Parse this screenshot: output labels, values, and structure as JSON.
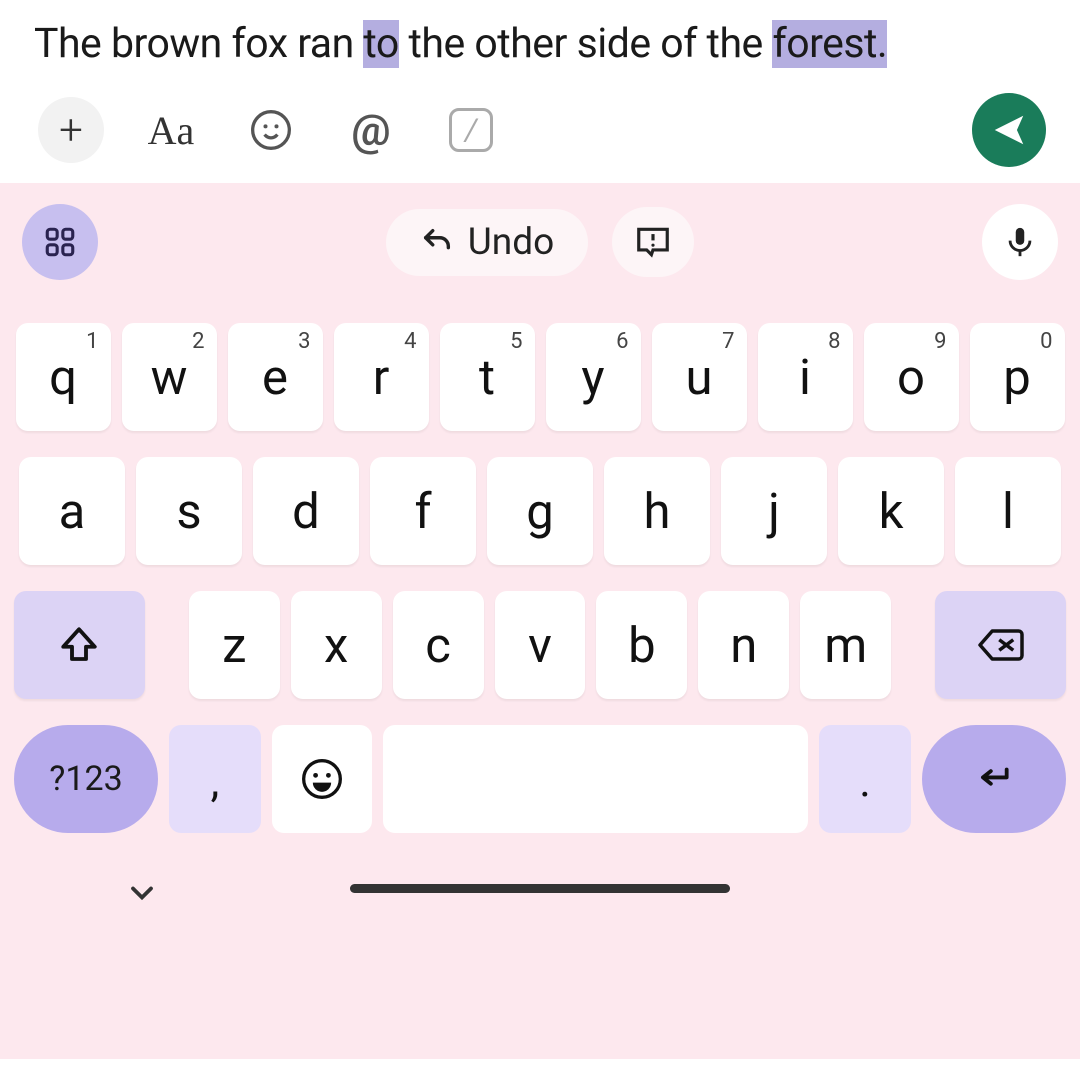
{
  "compose": {
    "segments": [
      {
        "t": "The brown fox ran ",
        "hl": false
      },
      {
        "t": "to",
        "hl": true
      },
      {
        "t": " the other side of the ",
        "hl": false
      },
      {
        "t": "forest.",
        "hl": true
      }
    ]
  },
  "format_bar": {
    "plus": "+",
    "aa": "Aa",
    "at": "@"
  },
  "keyboard": {
    "undo_label": "Undo",
    "row1": [
      {
        "k": "q",
        "s": "1"
      },
      {
        "k": "w",
        "s": "2"
      },
      {
        "k": "e",
        "s": "3"
      },
      {
        "k": "r",
        "s": "4"
      },
      {
        "k": "t",
        "s": "5"
      },
      {
        "k": "y",
        "s": "6"
      },
      {
        "k": "u",
        "s": "7"
      },
      {
        "k": "i",
        "s": "8"
      },
      {
        "k": "o",
        "s": "9"
      },
      {
        "k": "p",
        "s": "0"
      }
    ],
    "row2": [
      "a",
      "s",
      "d",
      "f",
      "g",
      "h",
      "j",
      "k",
      "l"
    ],
    "row3": [
      "z",
      "x",
      "c",
      "v",
      "b",
      "n",
      "m"
    ],
    "sym_label": "?123",
    "comma": ",",
    "period": "."
  }
}
